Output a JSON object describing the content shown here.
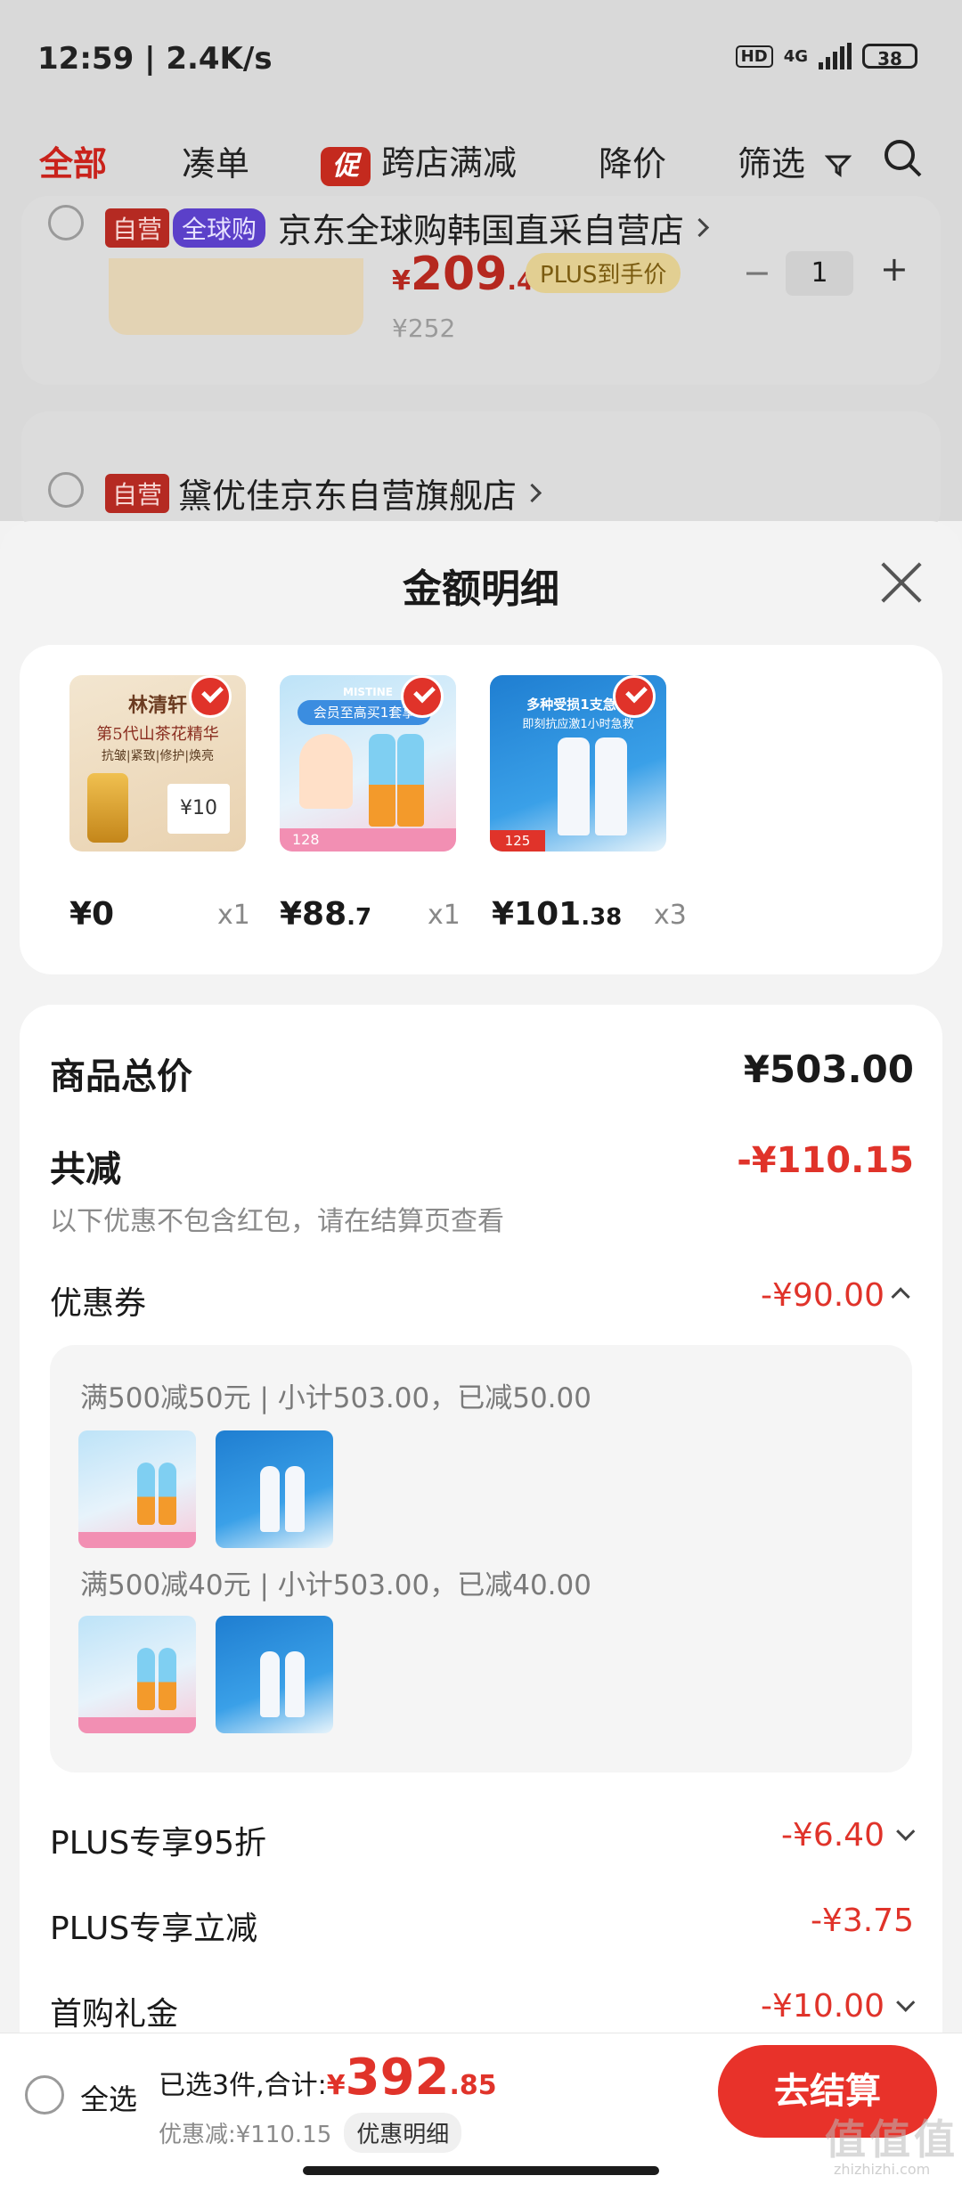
{
  "status_bar": {
    "time": "12:59 | 2.4K/s",
    "hd": "HD",
    "network": "4G",
    "battery": "38"
  },
  "tabs": [
    {
      "label": "全部"
    },
    {
      "label": "凑单"
    },
    {
      "label": "跨店满减",
      "badge": "促"
    },
    {
      "label": "降价"
    },
    {
      "label": "筛选"
    }
  ],
  "background": {
    "shop1": {
      "tag1": "自营",
      "tag2": "全球购",
      "name": "京东全球购韩国直采自营店",
      "price_symbol": "¥",
      "price": "209",
      "price_dec": ".4",
      "plus": "PLUS到手价",
      "orig_price": "¥252",
      "qty": "1"
    },
    "shop2": {
      "tag1": "自营",
      "name": "黛优佳京东自营旗舰店"
    }
  },
  "sheet": {
    "title": "金额明细",
    "items": [
      {
        "price_int": "¥0",
        "price_dec": "",
        "qty": "x1",
        "art_title": "林清轩",
        "art_sub": "第5代山茶花精华",
        "art_sub2": "抗皱|紧致|修护|焕亮",
        "art_badge": "¥10"
      },
      {
        "price_int": "¥88",
        "price_dec": ".7",
        "qty": "x1",
        "art_title": "MISTINE",
        "art_sub": "会员至高买1套享",
        "art_badge": "128"
      },
      {
        "price_int": "¥101",
        "price_dec": ".38",
        "qty": "x3",
        "art_title": "多种受损1支急救",
        "art_sub": "即刻抗应激1小时急救",
        "art_badge": "125"
      }
    ],
    "total_label": "商品总价",
    "total_value": "¥503.00",
    "reduce_label": "共减",
    "reduce_value": "-¥110.15",
    "reduce_note": "以下优惠不包含红包，请在结算页查看",
    "coupon_label": "优惠券",
    "coupon_value": "-¥90.00",
    "coupon_lines": [
      "满500减50元 | 小计503.00，已减50.00",
      "满500减40元 | 小计503.00，已减40.00"
    ],
    "plus95_label": "PLUS专享95折",
    "plus95_value": "-¥6.40",
    "plusreduce_label": "PLUS专享立减",
    "plusreduce_value": "-¥3.75",
    "firstbuy_label": "首购礼金",
    "firstbuy_value": "-¥10.00"
  },
  "bottom": {
    "select_all": "全选",
    "selected_text": "已选3件,合计:",
    "currency": "¥",
    "total_int": "392",
    "total_dec": ".85",
    "discount_text": "优惠减:¥110.15",
    "detail_button": "优惠明细",
    "checkout": "去结算"
  },
  "watermark": {
    "brand": "值",
    "url": "zhizhizhi.com"
  },
  "colors": {
    "accent": "#e8322a",
    "price_red": "#e0332a"
  }
}
